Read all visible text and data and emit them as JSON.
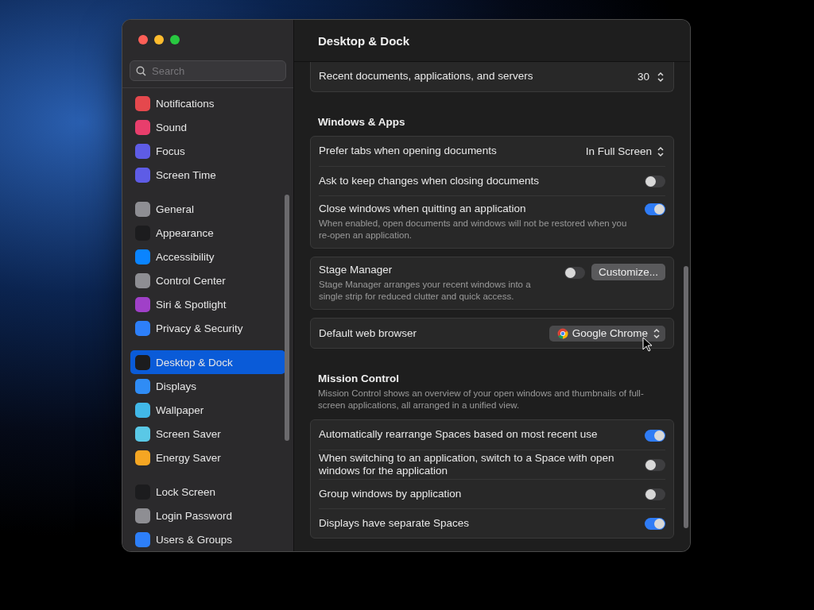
{
  "window": {
    "title": "Desktop & Dock"
  },
  "search": {
    "placeholder": "Search"
  },
  "sidebar": {
    "groups": [
      {
        "items": [
          {
            "label": "Notifications",
            "color": "#e5484d",
            "selected": false
          },
          {
            "label": "Sound",
            "color": "#e83e6c",
            "selected": false
          },
          {
            "label": "Focus",
            "color": "#5e5ce6",
            "selected": false
          },
          {
            "label": "Screen Time",
            "color": "#5e5ce6",
            "selected": false
          }
        ]
      },
      {
        "items": [
          {
            "label": "General",
            "color": "#8e8e93",
            "selected": false
          },
          {
            "label": "Appearance",
            "color": "#1c1c1e",
            "selected": false
          },
          {
            "label": "Accessibility",
            "color": "#0a84ff",
            "selected": false
          },
          {
            "label": "Control Center",
            "color": "#8e8e93",
            "selected": false
          },
          {
            "label": "Siri & Spotlight",
            "color": "#a040c8",
            "selected": false
          },
          {
            "label": "Privacy & Security",
            "color": "#2d7ff9",
            "selected": false
          }
        ]
      },
      {
        "items": [
          {
            "label": "Desktop & Dock",
            "color": "#1c1c1e",
            "selected": true
          },
          {
            "label": "Displays",
            "color": "#2f8cf5",
            "selected": false
          },
          {
            "label": "Wallpaper",
            "color": "#41b8e8",
            "selected": false
          },
          {
            "label": "Screen Saver",
            "color": "#5ac8e6",
            "selected": false
          },
          {
            "label": "Energy Saver",
            "color": "#f5a623",
            "selected": false
          }
        ]
      },
      {
        "items": [
          {
            "label": "Lock Screen",
            "color": "#1c1c1e",
            "selected": false
          },
          {
            "label": "Login Password",
            "color": "#8e8e93",
            "selected": false
          },
          {
            "label": "Users & Groups",
            "color": "#2d7ff9",
            "selected": false
          }
        ]
      }
    ]
  },
  "sections": [
    {
      "rows": [
        {
          "kind": "stepper",
          "label": "Recent documents, applications, and servers",
          "value": "30"
        }
      ]
    },
    {
      "heading": "Windows & Apps",
      "rows": [
        {
          "kind": "popup",
          "label": "Prefer tabs when opening documents",
          "value": "In Full Screen"
        },
        {
          "kind": "toggle",
          "label": "Ask to keep changes when closing documents",
          "on": false
        },
        {
          "kind": "toggle",
          "label": "Close windows when quitting an application",
          "description": "When enabled, open documents and windows will not be restored when you re-open an application.",
          "on": true
        }
      ]
    },
    {
      "rows": [
        {
          "kind": "toggle_button",
          "label": "Stage Manager",
          "description": "Stage Manager arranges your recent windows into a single strip for reduced clutter and quick access.",
          "on": false,
          "button": "Customize..."
        }
      ]
    },
    {
      "rows": [
        {
          "kind": "app_popup",
          "label": "Default web browser",
          "value": "Google Chrome"
        }
      ]
    },
    {
      "heading": "Mission Control",
      "description": "Mission Control shows an overview of your open windows and thumbnails of full-screen applications, all arranged in a unified view.",
      "rows": [
        {
          "kind": "toggle",
          "label": "Automatically rearrange Spaces based on most recent use",
          "on": true
        },
        {
          "kind": "toggle",
          "label": "When switching to an application, switch to a Space with open windows for the application",
          "on": false
        },
        {
          "kind": "toggle",
          "label": "Group windows by application",
          "on": false
        },
        {
          "kind": "toggle",
          "label": "Displays have separate Spaces",
          "on": true
        }
      ]
    }
  ]
}
